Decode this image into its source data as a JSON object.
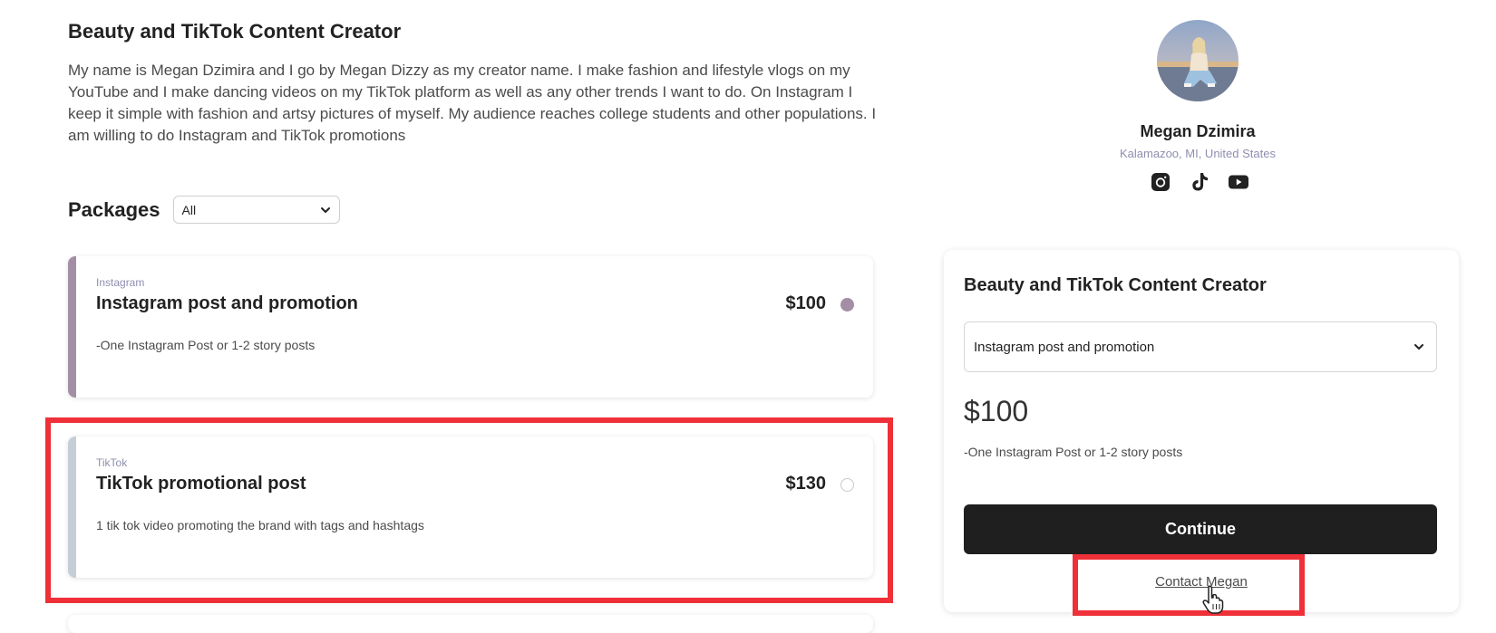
{
  "profile_header": {
    "title": "Beauty and TikTok Content Creator",
    "bio": "My name is Megan Dzimira and I go by Megan Dizzy as my creator name. I make fashion and lifestyle vlogs on my YouTube and I make dancing videos on my TikTok platform as well as any other trends I want to do. On Instagram I keep it simple with fashion and artsy pictures of myself. My audience reaches college students and other populations. I am willing to do Instagram and TikTok promotions"
  },
  "packages": {
    "heading": "Packages",
    "filter_value": "All",
    "items": [
      {
        "platform": "Instagram",
        "name": "Instagram post and promotion",
        "price": "$100",
        "description": "-One Instagram Post or 1-2 story posts",
        "selected": true,
        "stripe_color": "#a48ea6"
      },
      {
        "platform": "TikTok",
        "name": "TikTok promotional post",
        "price": "$130",
        "description": "1 tik tok video promoting the brand with tags and hashtags",
        "selected": false,
        "stripe_color": "#c5ced6"
      }
    ]
  },
  "creator": {
    "name": "Megan Dzimira",
    "location": "Kalamazoo, MI, United States",
    "socials": [
      "instagram-icon",
      "tiktok-icon",
      "youtube-icon"
    ]
  },
  "booking_card": {
    "title": "Beauty and TikTok Content Creator",
    "selected_package": "Instagram post and promotion",
    "price": "$100",
    "description": "-One Instagram Post or 1-2 story posts",
    "continue_label": "Continue",
    "contact_label": "Contact Megan"
  },
  "colors": {
    "accent_dark": "#1f1f1f",
    "muted_label": "#8e8eb0",
    "selected_radio": "#a48ea6",
    "highlight": "#ef3038"
  }
}
